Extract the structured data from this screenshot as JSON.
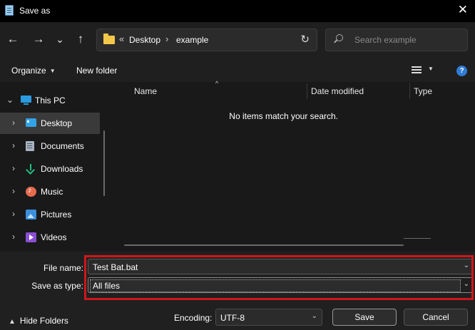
{
  "window": {
    "title": "Save as",
    "close_glyph": "✕"
  },
  "nav": {
    "back_glyph": "←",
    "forward_glyph": "→",
    "recent_glyph": "⌄",
    "up_glyph": "↑",
    "address": {
      "overflow": "«",
      "crumbs": [
        "Desktop",
        "example"
      ],
      "separator": "›"
    },
    "refresh_glyph": "↻",
    "search_placeholder": "Search example"
  },
  "toolbar": {
    "organize_label": "Organize",
    "new_folder_label": "New folder",
    "help_glyph": "?"
  },
  "sidebar": {
    "items": [
      {
        "label": "This PC",
        "icon": "computer-icon"
      },
      {
        "label": "Desktop",
        "icon": "desktop-icon",
        "selected": true
      },
      {
        "label": "Documents",
        "icon": "documents-icon"
      },
      {
        "label": "Downloads",
        "icon": "download-icon"
      },
      {
        "label": "Music",
        "icon": "music-icon"
      },
      {
        "label": "Pictures",
        "icon": "pictures-icon"
      },
      {
        "label": "Videos",
        "icon": "videos-icon"
      }
    ],
    "chevron_glyph": "›"
  },
  "filelist": {
    "columns": [
      "Name",
      "Date modified",
      "Type"
    ],
    "sort_glyph": "^",
    "empty_message": "No items match your search."
  },
  "form": {
    "file_name_label": "File name:",
    "file_name_value": "Test Bat.bat",
    "save_type_label": "Save as type:",
    "save_type_value": "All files",
    "highlight_color": "#d0161b"
  },
  "footer": {
    "hide_folders_label": "Hide Folders",
    "encoding_label": "Encoding:",
    "encoding_value": "UTF-8",
    "save_label": "Save",
    "cancel_label": "Cancel"
  }
}
